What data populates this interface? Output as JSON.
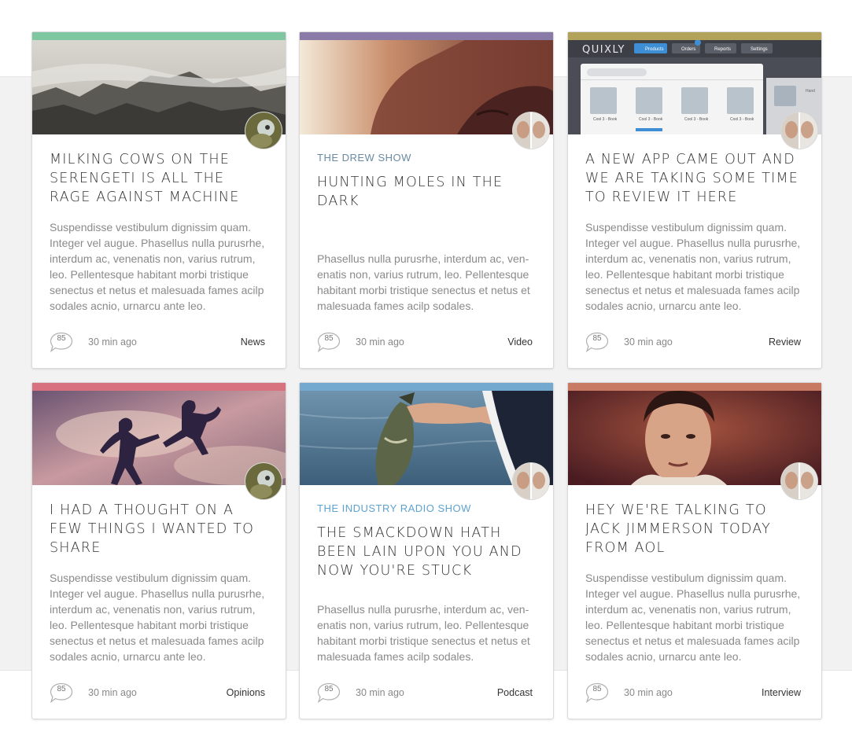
{
  "cards": [
    {
      "show": "",
      "title": "Milking Cows on the Serengeti is all the rage against machine",
      "body": "Suspendisse vestibulum dignissim quam. Integer vel augue. Phasellus nulla purusrhe, interdum ac, venenatis non, varius rutrum, leo. Pellentesque habitant morbi tristique senectus et netus et malesuada fames acilp sodales acnio, urnarcu ante leo.",
      "comments": "85",
      "time": "30 min ago",
      "category": "News",
      "accent": "#7fc7a0"
    },
    {
      "show": "The Drew Show",
      "title": "Hunting Moles in the Dark",
      "body": "Phasellus nulla purusrhe, interdum ac, ven-enatis non, varius rutrum, leo. Pellentesque habitant morbi tristique senectus et netus et malesuada fames acilp sodales.",
      "comments": "85",
      "time": "30 min ago",
      "category": "Video",
      "accent": "#8a7aa8"
    },
    {
      "show": "",
      "title": "A new app came out and we are taking some time to review it here",
      "body": "Suspendisse vestibulum dignissim quam. Integer vel augue. Phasellus nulla purusrhe, interdum ac, venenatis non, varius rutrum, leo. Pellentesque habitant morbi tristique senectus et netus et malesuada fames acilp sodales acnio, urnarcu ante leo.",
      "comments": "85",
      "time": "30 min ago",
      "category": "Review",
      "accent": "#b3a35a",
      "app": {
        "logo": "QUIXLY",
        "nav": [
          "Products",
          "Orders",
          "Reports",
          "Settings"
        ],
        "items": [
          "Cool 3 - Book",
          "Cool 3 - Book",
          "Cool 3 - Book",
          "Cool 3 - Book"
        ],
        "side_label": "Hand"
      }
    },
    {
      "show": "",
      "title": "I had a thought on a few things I wanted to share",
      "body": "Suspendisse vestibulum dignissim quam. Integer vel augue. Phasellus nulla purusrhe, interdum ac, venenatis non, varius rutrum, leo. Pellentesque habitant morbi tristique senectus et netus et malesuada fames acilp sodales acnio, urnarcu ante leo.",
      "comments": "85",
      "time": "30 min ago",
      "category": "Opinions",
      "accent": "#d8727f"
    },
    {
      "show": "The Industry Radio Show",
      "title": "The Smackdown Hath Been Lain upon you and now you're stuck",
      "body": "Phasellus nulla purusrhe, interdum ac, ven-enatis non, varius rutrum, leo. Pellentesque habitant morbi tristique senectus et netus et malesuada fames acilp sodales.",
      "comments": "85",
      "time": "30 min ago",
      "category": "Podcast",
      "accent": "#74a9cf"
    },
    {
      "show": "",
      "title": "Hey we're talking to Jack Jimmerson today from AOL",
      "body": "Suspendisse vestibulum dignissim quam. Integer vel augue. Phasellus nulla purusrhe, interdum ac, venenatis non, varius rutrum, leo. Pellentesque habitant morbi tristique senectus et netus et malesuada fames acilp sodales acnio, urnarcu ante leo.",
      "comments": "85",
      "time": "30 min ago",
      "category": "Interview",
      "accent": "#c97a62"
    }
  ]
}
